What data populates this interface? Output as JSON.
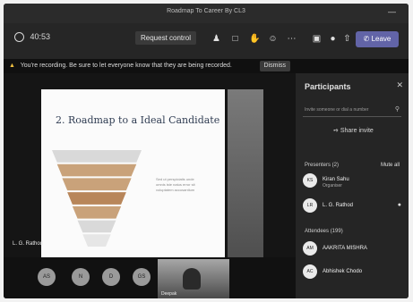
{
  "window": {
    "title": "Roadmap To Career By CL3"
  },
  "toolbar": {
    "timer": "40:53",
    "request_control": "Request control",
    "icons": [
      "participants-icon",
      "chat-icon",
      "raise-hand-icon",
      "reactions-icon",
      "more-icon",
      "camera-icon",
      "mic-icon",
      "share-icon"
    ],
    "leave_label": "Leave"
  },
  "notice": {
    "text": "You're recording. Be sure to let everyone know that they are being recorded.",
    "dismiss_label": "Dismiss"
  },
  "slide": {
    "title": "2. Roadmap to a Ideal Candidate",
    "funnel_colors": [
      "#d9d9d9",
      "#c9a27a",
      "#c9a27a",
      "#b8865a",
      "#c9a27a",
      "#d9d9d9",
      "#e6e6e6"
    ],
    "notes": "Sed ut perspiciatis unde omnis iste natus error sit voluptatem accusantium"
  },
  "stage": {
    "presenter_name": "L. G. Rathod",
    "bottom_avatars": [
      "AS",
      "N",
      "D",
      "GS"
    ],
    "video_name": "Deepak"
  },
  "participants": {
    "title": "Participants",
    "search_placeholder": "Invite someone or dial a number",
    "share_invite": "Share invite",
    "presenters_header": "Presenters (2)",
    "mute_all": "Mute all",
    "presenters": [
      {
        "initials": "KS",
        "name": "Kiran Sahu",
        "role": "Organiser"
      },
      {
        "initials": "LR",
        "name": "L. G. Rathod",
        "role": ""
      }
    ],
    "attendees_header": "Attendees (199)",
    "attendees": [
      {
        "initials": "AM",
        "name": "AAKRITA MISHRA"
      },
      {
        "initials": "AC",
        "name": "Abhishek Chodo"
      }
    ]
  }
}
